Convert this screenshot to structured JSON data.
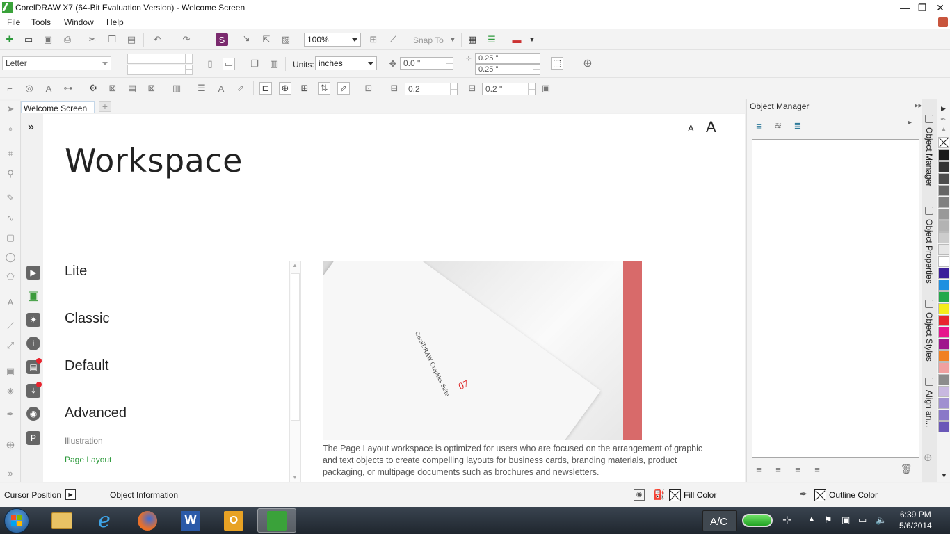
{
  "window": {
    "title": "CorelDRAW X7 (64-Bit Evaluation Version) - Welcome Screen",
    "controls": {
      "minimize": "—",
      "restore": "❐",
      "close": "✕"
    }
  },
  "menu": {
    "items": [
      "File",
      "Tools",
      "Window",
      "Help"
    ]
  },
  "standard_toolbar": {
    "zoom_value": "100%",
    "snap_to_label": "Snap To"
  },
  "property_bar": {
    "page_size": "Letter",
    "units_label": "Units:",
    "units_value": "inches",
    "nudge_value": "0.0 \"",
    "dup_x": "0.25 \"",
    "dup_y": "0.25 \""
  },
  "third_bar": {
    "spin_a": "0.2",
    "spin_b": "0.2 \""
  },
  "doc_tab": {
    "label": "Welcome Screen",
    "new_tab": "+"
  },
  "welcome": {
    "expand_glyph": "»",
    "font_small": "A",
    "font_large": "A",
    "title": "Workspace",
    "options": [
      "Lite",
      "Classic",
      "Default",
      "Advanced"
    ],
    "sub_options": [
      "Illustration",
      "Page Layout"
    ],
    "preview": {
      "spine_text": "CorelDRAW Graphics Suite",
      "page_number": "07"
    },
    "description": "The Page Layout workspace is optimized for users who are focused on the arrangement of graphic and text objects to create compelling layouts for business cards, branding materials, product packaging, or multipage documents such as brochures and newsletters."
  },
  "docker": {
    "title": "Object Manager",
    "tabs": [
      "Object Manager",
      "Object Properties",
      "Object Styles",
      "Align an..."
    ]
  },
  "palette": {
    "colors": [
      "#1a1a1a",
      "#333333",
      "#4d4d4d",
      "#666666",
      "#808080",
      "#999999",
      "#b3b3b3",
      "#cccccc",
      "#e6e6e6",
      "#ffffff",
      "#3b1f9a",
      "#1e90e0",
      "#22a84a",
      "#f4ec1c",
      "#e8242e",
      "#e6148c",
      "#a0158c",
      "#f08022",
      "#f0a0a0",
      "#8c8c8c",
      "#c8b8e0",
      "#a090d0",
      "#8a78c8",
      "#6a58b8"
    ]
  },
  "status": {
    "cursor_position": "Cursor Position",
    "object_information": "Object Information",
    "fill_color": "Fill Color",
    "outline_color": "Outline Color"
  },
  "taskbar": {
    "power_label": "A/C",
    "time": "6:39 PM",
    "date": "5/6/2014"
  }
}
